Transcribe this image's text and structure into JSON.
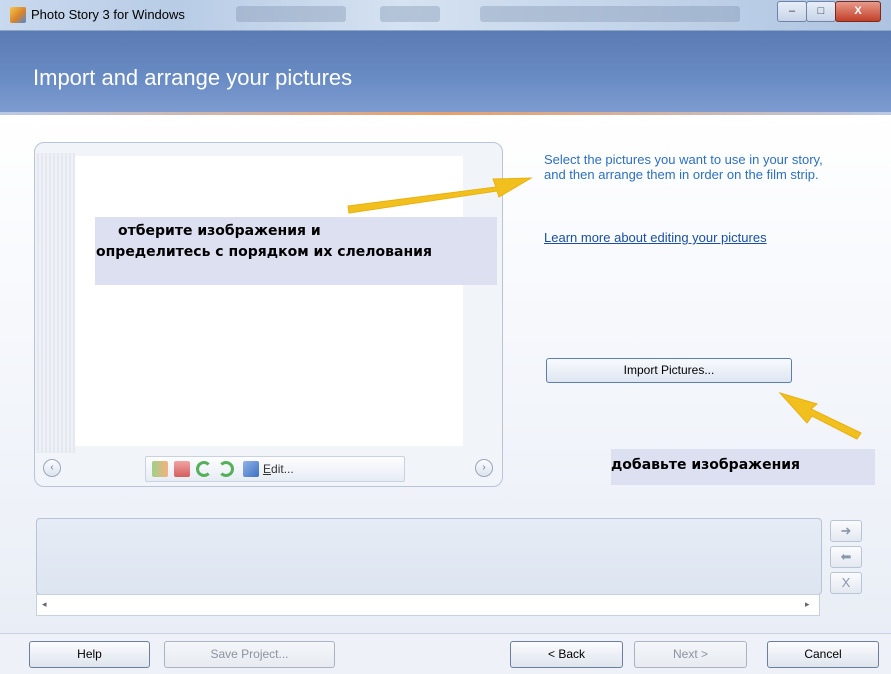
{
  "window": {
    "title": "Photo Story 3 for Windows",
    "controls": {
      "minimize": "–",
      "maximize": "□",
      "close": "X"
    }
  },
  "header": {
    "title": "Import and arrange your pictures"
  },
  "preview": {
    "prev_icon": "chevron-left-icon",
    "next_icon": "chevron-right-icon",
    "edit_label": "Edit...",
    "tools": [
      "auto-levels-icon",
      "red-eye-icon",
      "rotate-left-icon",
      "rotate-right-icon",
      "edit-icon"
    ]
  },
  "instructions": "Select the pictures you want to use in your story, and then arrange them in order on the film strip.",
  "learn_more_link": "Learn more about editing your pictures",
  "import_button": "Import Pictures...",
  "annotations": {
    "note1_line1": "отберите изображения и",
    "note1_line2": "определитесь с порядком их слелования",
    "note2": "добавьте изображения",
    "arrow_color": "#f2c01e"
  },
  "filmstrip": {
    "scroll_left": "◂",
    "scroll_right": "▸",
    "move_right": "➜",
    "move_left": "⬅",
    "remove": "X"
  },
  "footer": {
    "help": "Help",
    "save_project": "Save Project...",
    "back": "< Back",
    "next": "Next >",
    "cancel": "Cancel"
  }
}
